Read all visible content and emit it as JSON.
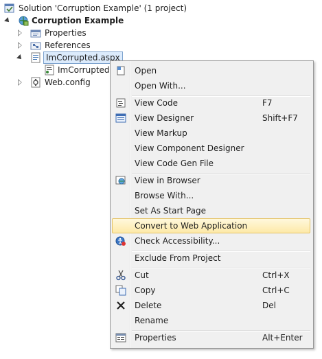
{
  "tree": {
    "solution_label": "Solution 'Corruption Example' (1 project)",
    "project_label": "Corruption Example",
    "properties_label": "Properties",
    "references_label": "References",
    "selected_file_label": "ImCorrupted.aspx",
    "child_file_label": "ImCorrupted.a",
    "webconfig_label": "Web.config"
  },
  "menu": {
    "items": [
      {
        "label": "Open",
        "shortcut": ""
      },
      {
        "label": "Open With...",
        "shortcut": ""
      },
      {
        "label": "View Code",
        "shortcut": "F7"
      },
      {
        "label": "View Designer",
        "shortcut": "Shift+F7"
      },
      {
        "label": "View Markup",
        "shortcut": ""
      },
      {
        "label": "View Component Designer",
        "shortcut": ""
      },
      {
        "label": "View Code Gen File",
        "shortcut": ""
      },
      {
        "label": "View in Browser",
        "shortcut": ""
      },
      {
        "label": "Browse With...",
        "shortcut": ""
      },
      {
        "label": "Set As Start Page",
        "shortcut": ""
      },
      {
        "label": "Convert to Web Application",
        "shortcut": ""
      },
      {
        "label": "Check Accessibility...",
        "shortcut": ""
      },
      {
        "label": "Exclude From Project",
        "shortcut": ""
      },
      {
        "label": "Cut",
        "shortcut": "Ctrl+X"
      },
      {
        "label": "Copy",
        "shortcut": "Ctrl+C"
      },
      {
        "label": "Delete",
        "shortcut": "Del"
      },
      {
        "label": "Rename",
        "shortcut": ""
      },
      {
        "label": "Properties",
        "shortcut": "Alt+Enter"
      }
    ],
    "highlighted_item": "Convert to Web Application"
  },
  "colors": {
    "highlight_border": "#e5c365",
    "highlight_fill": "#fde9a8",
    "selection_border": "#7da2ce",
    "menu_background": "#f0f0f0"
  },
  "icons": {
    "solution": "solution-icon",
    "project": "web-project-icon",
    "properties": "properties-folder-icon",
    "references": "references-folder-icon",
    "aspx": "aspx-file-icon",
    "codebehind": "code-file-icon",
    "webconfig": "config-file-icon"
  }
}
